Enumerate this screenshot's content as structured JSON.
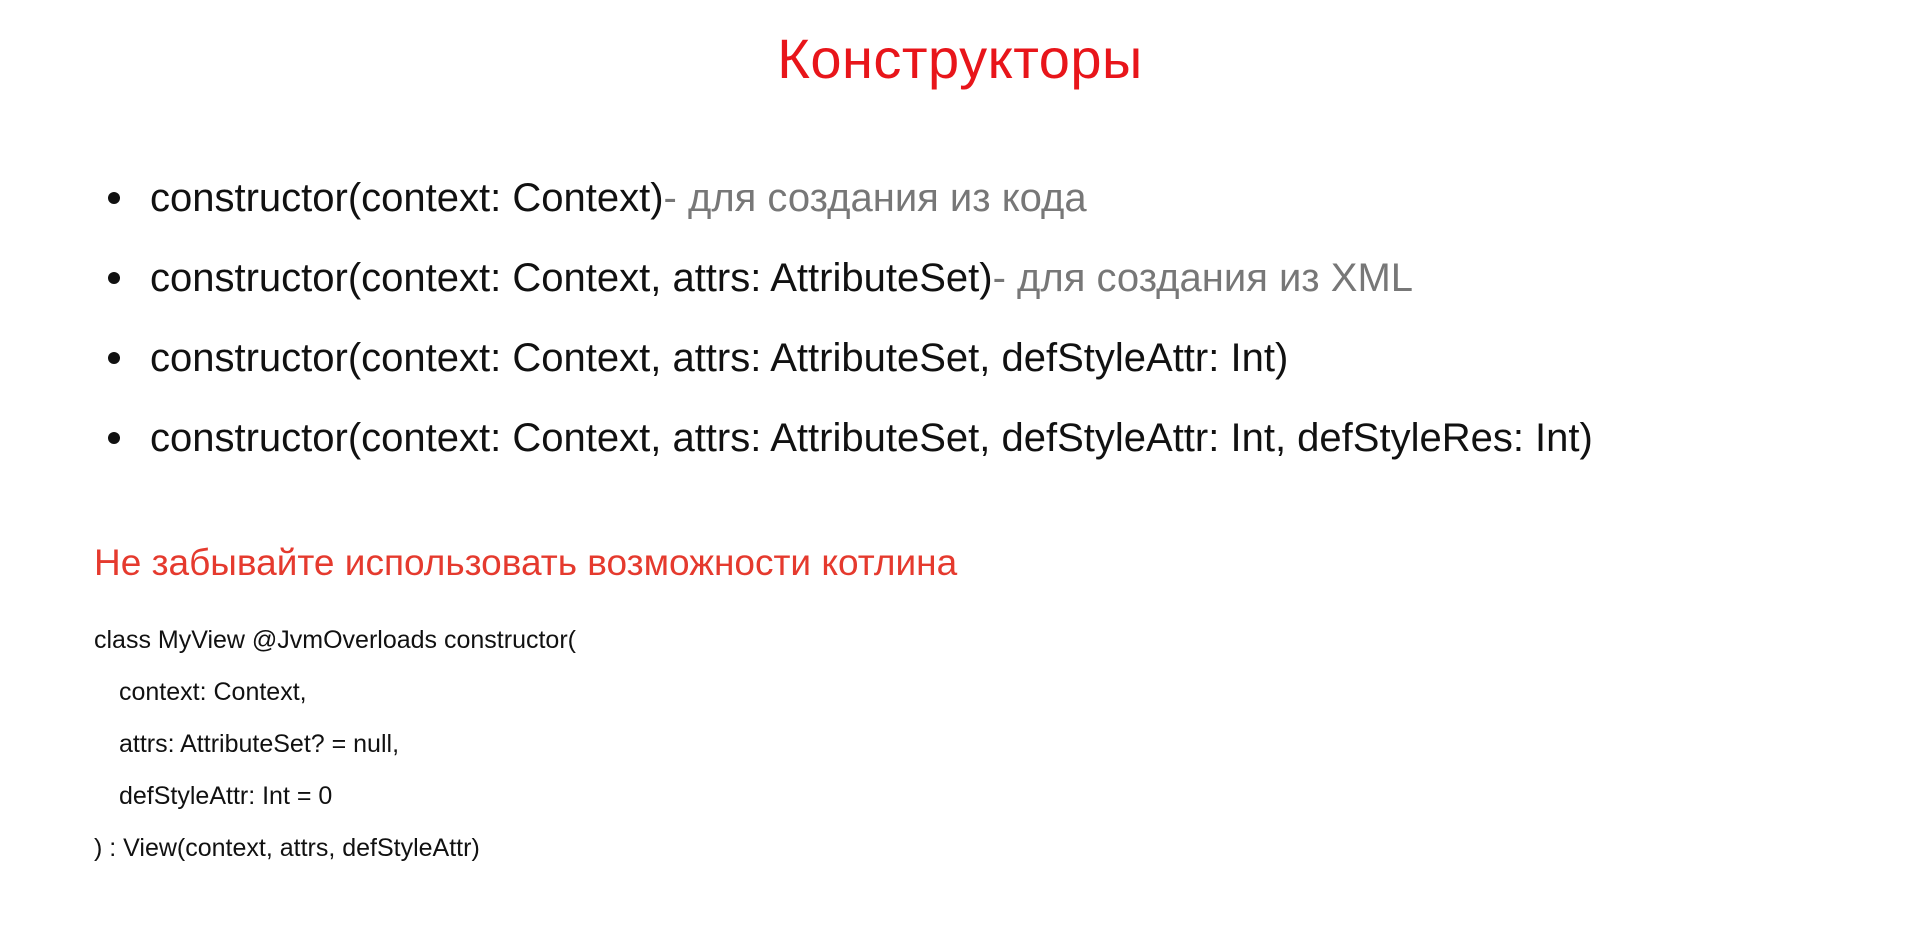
{
  "slide": {
    "title": "Конструкторы",
    "bullets": [
      {
        "signature": "constructor(context: Context)",
        "note": " - для создания из кода"
      },
      {
        "signature": "constructor(context: Context, attrs: AttributeSet)",
        "note": " - для создания из XML"
      },
      {
        "signature": "constructor(context: Context, attrs: AttributeSet, defStyleAttr: Int)",
        "note": ""
      },
      {
        "signature": "constructor(context: Context, attrs: AttributeSet, defStyleAttr: Int, defStyleRes: Int)",
        "note": ""
      }
    ],
    "subheading": "Не забывайте использовать возможности котлина",
    "code_lines": [
      "class MyView @JvmOverloads constructor(",
      "context: Context,",
      "attrs: AttributeSet? = null,",
      "defStyleAttr: Int = 0",
      ") : View(context, attrs, defStyleAttr)"
    ],
    "colors": {
      "title": "#e8151a",
      "subheading": "#e53a2e",
      "note": "#777777",
      "text": "#111111",
      "background": "#ffffff"
    }
  }
}
